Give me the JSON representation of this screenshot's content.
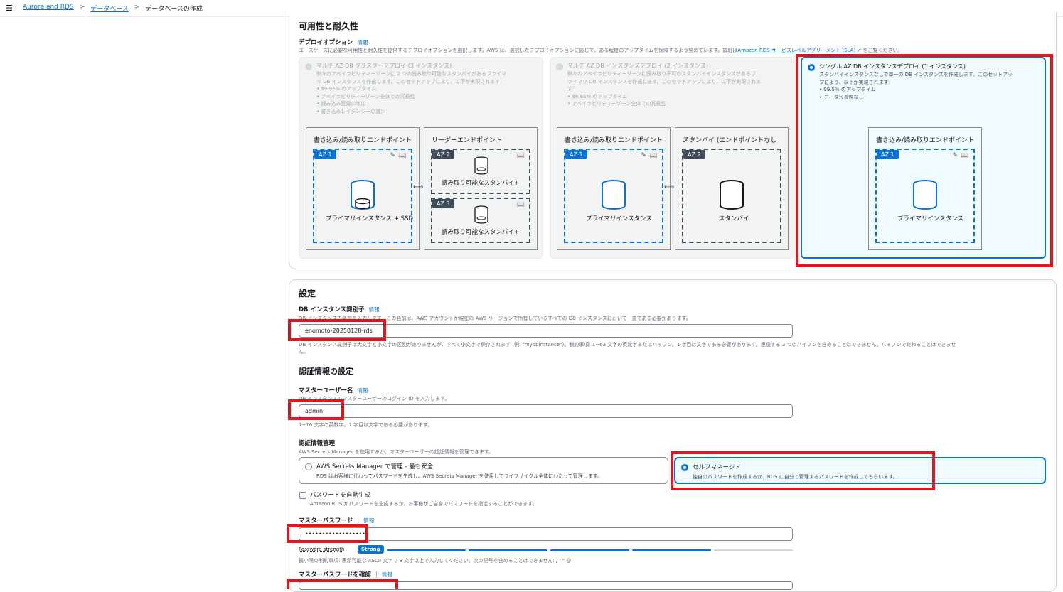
{
  "breadcrumb": {
    "menu_icon": "menu-icon",
    "items": [
      "Aurora and RDS",
      "データベース"
    ],
    "current": "データベースの作成",
    "separator": ">"
  },
  "availability": {
    "title": "可用性と耐久性",
    "deploy_label": "デプロイオプション",
    "info": "情報",
    "deploy_desc": "ユースケースに必要な可用性と耐久性を提供するデプロイオプションを選択します。AWS は、選択したデプロイオプションに応じて、ある程度のアップタイムを保障するよう努めています。詳細は",
    "sla_link": "Amazon RDS サービスレベルアグリーメント (SLA)",
    "deploy_desc_end": "をご覧ください。",
    "cards": [
      {
        "title": "マルチ AZ DB クラスターデプロイ (3 インスタンス)",
        "desc": "例々のアベイラビリティーゾーンに 2 つの読み取り可能なスタンバイがあるプライマ\nリ DB インスタンスを作成します。このセットアップにより、以下が実現されます:\n•  99.95% のアップタイム\n•  アベイラビリティーゾーン全体での冗長性\n•  読み込み容量の増加\n•  書き込みレイテンシーの減少",
        "diagram": {
          "rw_title": "書き込み/読み取りエンドポイント",
          "ro_title": "リーダーエンドポイント",
          "az1": "AZ 1",
          "az2": "AZ 2",
          "az3": "AZ 3",
          "primary": "プライマリインスタンス + SSD",
          "standby_readable": "読み取り可能なスタンバイ+"
        }
      },
      {
        "title": "マルチ AZ DB インスタンスデプロイ (2 インスタンス)",
        "desc": "例々のアベイラビリティーゾーンに読み取り不可のスタンバイインスタンスがあるプ\nライマリ DB インスタンスを作成します。このセットアップにより、以下が実現されま\nす:\n•  99.95% のアップタイム\n•  アベイラビリティーゾーン全体での冗長性",
        "diagram": {
          "rw_title": "書き込み/読み取りエンドポイント",
          "standby_title": "スタンバイ (エンドポイントなし",
          "az1": "AZ 1",
          "az2": "AZ 2",
          "primary": "プライマリインスタンス",
          "standby": "スタンバイ"
        }
      },
      {
        "title": "シングル AZ DB インスタンスデプロイ (1 インスタンス)",
        "desc": "スタンバイインスタンスなしで単一の DB インスタンスを作成します。このセットアッ\nプにより、以下が実現されます:\n•  99.5% のアップタイム\n•  データ冗長性なし",
        "diagram": {
          "rw_title": "書き込み/読み取りエンドポイント",
          "az1": "AZ 1",
          "primary": "プライマリインスタンス"
        }
      }
    ]
  },
  "settings": {
    "title": "設定",
    "identifier_label": "DB インスタンス識別子",
    "info": "情報",
    "identifier_desc": "DB インスタンスの名前を入力します。この名前は、AWS アカウントが現在の AWS リージョンで所有しているすべての DB インスタンスにおいて一意である必要があります。",
    "identifier_value": "enomoto-20250128-rds",
    "identifier_hint": "DB インスタンス識別子は大文字と小文字の区別がありませんが、すべて小文字で保存されます (例: \"mydbinstance\")。制約事項: 1~63 文字の英数字またはハイフン。1 字目は文字である必要があります。連続する 2 つのハイフンを含めることはできません。ハイフンで終わることはできませ",
    "identifier_hint2": "ん。",
    "credentials_title": "認証情報の設定",
    "master_user_label": "マスターユーザー名",
    "master_user_desc": "DB インスタンスのマスターユーザーのログイン ID を入力します。",
    "master_user_value": "admin",
    "master_user_hint": "1~16 文字の英数字。1 字目は文字である必要があります。",
    "cred_mgmt_label": "認証情報管理",
    "cred_mgmt_desc": "AWS Secrets Manager を使用するか、マスターユーザーの認証情報を管理できます。",
    "opt_secrets_title": "AWS Secrets Manager で管理 - 最も安全",
    "opt_secrets_desc": "RDS はお客様に代わってパスワードを生成し、AWS Secrets Manager を使用してライフサイクル全体にわたって管理します。",
    "opt_self_title": "セルフマネージド",
    "opt_self_desc": "独自のパスワードを作成するか、RDS に自分で管理するパスワードを作成してもらいます。",
    "autogen_label": "パスワードを自動生成",
    "autogen_desc": "Amazon RDS がパスワードを生成するか、お客様がご自身でパスワードを指定することができます。",
    "master_pw_label": "マスターパスワード",
    "master_pw_value": "••••••••••••••••••",
    "strength_label": "Password strength",
    "strength_value": "Strong",
    "pw_hint": "最小限の制約事項: 表示可能な ASCII 文字で 8 文字以上で入力してください。次の記号を含めることはできません: / ' \" @",
    "confirm_pw_label": "マスターパスワードを確認"
  },
  "colors": {
    "accent": "#0972d3",
    "highlight": "#e0161e"
  }
}
